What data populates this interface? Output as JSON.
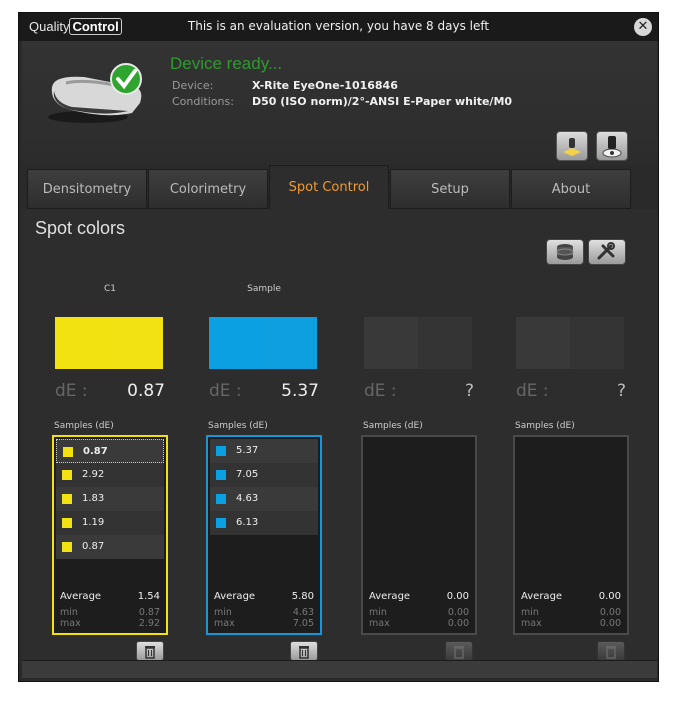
{
  "window": {
    "logo_a": "Quality",
    "logo_b": "Control",
    "title": "This is an evaluation version, you have 8 days left",
    "close": "✕"
  },
  "header": {
    "status": "Device ready...",
    "device_label": "Device:",
    "device_value": "X-Rite EyeOne-1016846",
    "conditions_label": "Conditions:",
    "conditions_value": "D50 (ISO norm)/2°-ANSI E-Paper white/M0"
  },
  "tabs": [
    {
      "label": "Densitometry"
    },
    {
      "label": "Colorimetry"
    },
    {
      "label": "Spot Control"
    },
    {
      "label": "Setup"
    },
    {
      "label": "About"
    }
  ],
  "section_title": "Spot colors",
  "colors": {
    "accent": "#f29a2a",
    "yellow": "#f2e212",
    "cyan": "#0aa0e2",
    "status": "#2f9a2f"
  },
  "columns": [
    {
      "label": "C1",
      "de_label": "dE :",
      "de_value": "0.87",
      "samples_label": "Samples (dE)",
      "samples": [
        "0.87",
        "2.92",
        "1.83",
        "1.19",
        "0.87"
      ],
      "average_label": "Average",
      "average": "1.54",
      "min_label": "min",
      "min": "0.87",
      "max_label": "max",
      "max": "2.92"
    },
    {
      "label": "Sample",
      "de_label": "dE :",
      "de_value": "5.37",
      "samples_label": "Samples (dE)",
      "samples": [
        "5.37",
        "7.05",
        "4.63",
        "6.13"
      ],
      "average_label": "Average",
      "average": "5.80",
      "min_label": "min",
      "min": "4.63",
      "max_label": "max",
      "max": "7.05"
    },
    {
      "label": "",
      "de_label": "dE :",
      "de_value": "?",
      "samples_label": "Samples (dE)",
      "samples": [],
      "average_label": "Average",
      "average": "0.00",
      "min_label": "min",
      "min": "0.00",
      "max_label": "max",
      "max": "0.00"
    },
    {
      "label": "",
      "de_label": "dE :",
      "de_value": "?",
      "samples_label": "Samples (dE)",
      "samples": [],
      "average_label": "Average",
      "average": "0.00",
      "min_label": "min",
      "min": "0.00",
      "max_label": "max",
      "max": "0.00"
    }
  ]
}
